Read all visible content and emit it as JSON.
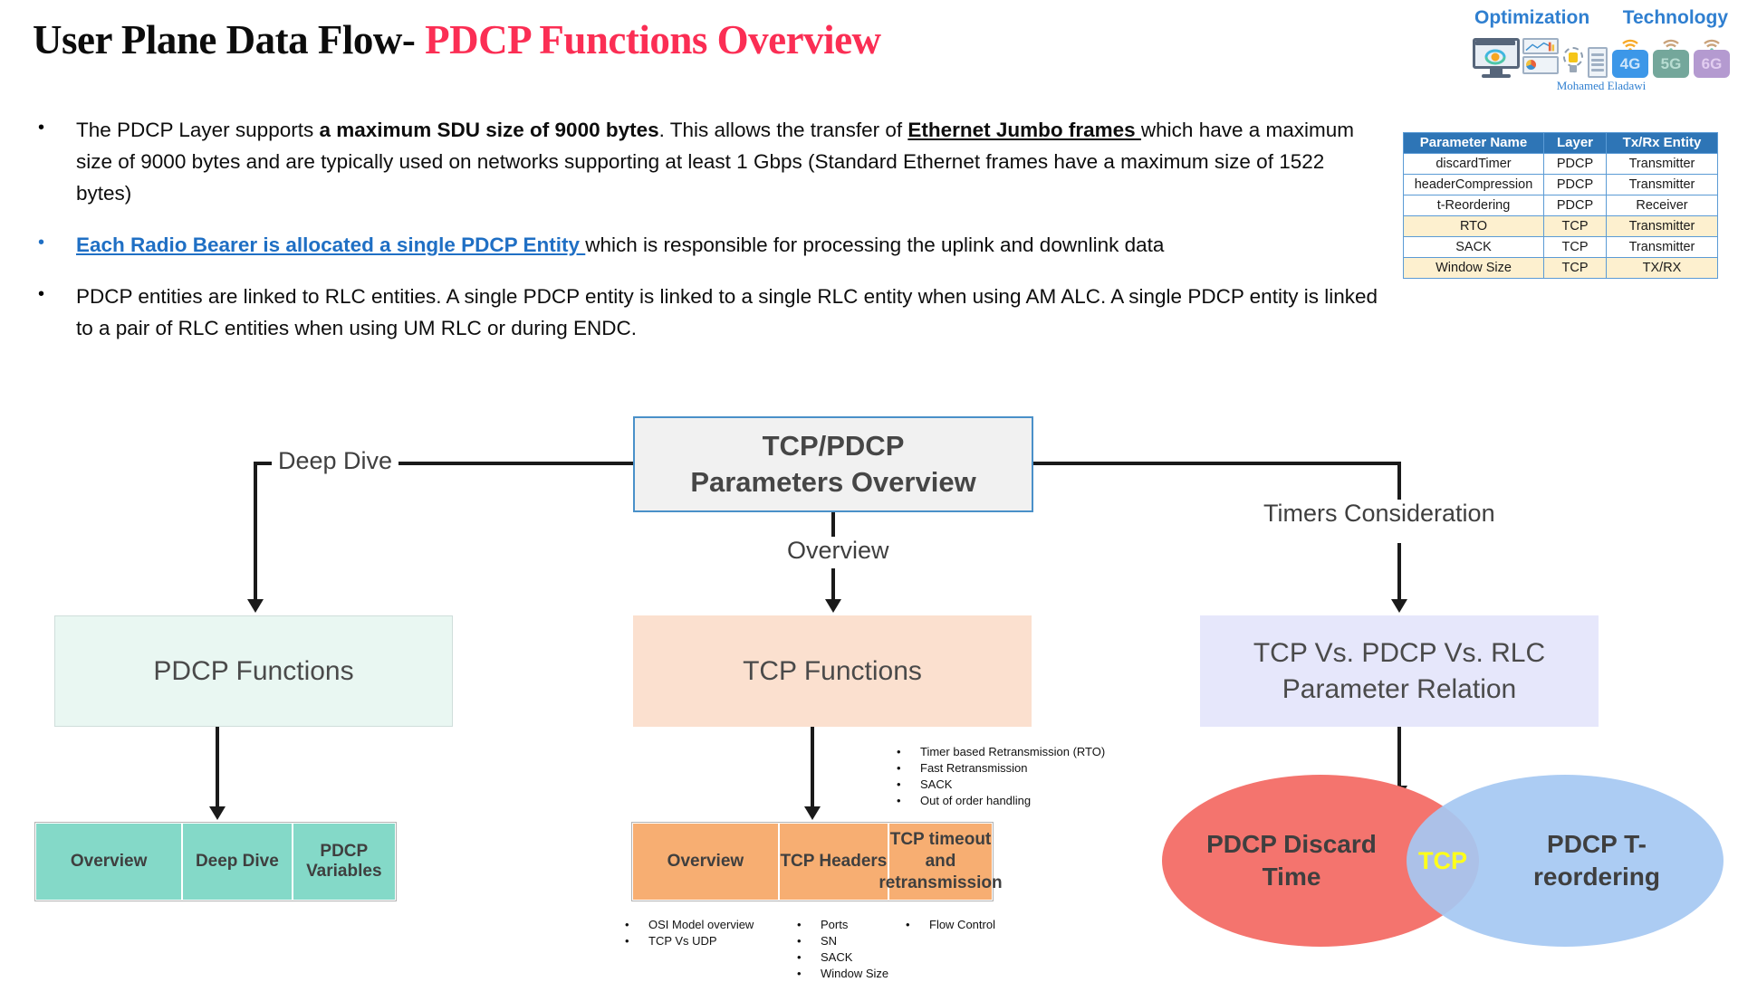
{
  "title": {
    "part1": "User Plane Data Flow- ",
    "part2": "PDCP Functions Overview"
  },
  "logo": {
    "word_left": "Optimization",
    "word_right": "Technology",
    "author": "Mohamed Eladawi",
    "cells": [
      "4G",
      "5G",
      "6G"
    ],
    "accent": "#2f7fd0"
  },
  "bullets": [
    {
      "marker": "•",
      "segments": [
        {
          "text": "The PDCP Layer supports ",
          "style": "plain"
        },
        {
          "text": "a maximum SDU size of 9000 bytes",
          "style": "bold"
        },
        {
          "text": ". This allows the transfer of ",
          "style": "plain"
        },
        {
          "text": "Ethernet Jumbo frames ",
          "style": "bold-underline"
        },
        {
          "text": "which have a maximum size of 9000 bytes and are typically used on networks supporting at least 1 Gbps (Standard Ethernet frames have a maximum size of 1522 bytes)",
          "style": "plain"
        }
      ]
    },
    {
      "marker": "•",
      "segments": [
        {
          "text": "Each Radio Bearer is allocated a single PDCP Entity ",
          "style": "link"
        },
        {
          "text": "which is responsible for processing the uplink and downlink data",
          "style": "plain"
        }
      ]
    },
    {
      "marker": "•",
      "segments": [
        {
          "text": "PDCP entities are linked to RLC entities. A single PDCP entity is linked to a single RLC entity when using AM ALC. A single PDCP entity is linked to a pair of RLC entities when using UM RLC or during ENDC.",
          "style": "plain"
        }
      ]
    }
  ],
  "param_table": {
    "headers": [
      "Parameter Name",
      "Layer",
      "Tx/Rx Entity"
    ],
    "rows": [
      {
        "cells": [
          "discardTimer",
          "PDCP",
          "Transmitter"
        ],
        "highlight": false
      },
      {
        "cells": [
          "headerCompression",
          "PDCP",
          "Transmitter"
        ],
        "highlight": false
      },
      {
        "cells": [
          "t-Reordering",
          "PDCP",
          "Receiver"
        ],
        "highlight": false
      },
      {
        "cells": [
          "RTO",
          "TCP",
          "Transmitter"
        ],
        "highlight": true
      },
      {
        "cells": [
          "SACK",
          "TCP",
          "Transmitter"
        ],
        "highlight": false
      },
      {
        "cells": [
          "Window Size",
          "TCP",
          "TX/RX"
        ],
        "highlight": true
      }
    ],
    "header_color": "#2e75b6",
    "highlight_color": "#fdf0cf"
  },
  "flow": {
    "root": {
      "line1": "TCP/PDCP",
      "line2": "Parameters Overview",
      "border_color": "#4a90c9",
      "fill": "#f1f1f1"
    },
    "edge_labels": {
      "left": "Deep Dive",
      "center": "Overview",
      "right": "Timers Consideration"
    },
    "nodes": {
      "pdcp_functions": {
        "label": "PDCP Functions",
        "fill": "#e9f7f2"
      },
      "tcp_functions": {
        "label": "TCP Functions",
        "fill": "#fbe0cf"
      },
      "relation": {
        "line1": "TCP Vs. PDCP Vs. RLC",
        "line2": "Parameter Relation",
        "fill": "#e6e7fb"
      }
    },
    "pdcp_sub": {
      "fill": "#84d9c8",
      "items": [
        "Overview",
        "Deep Dive",
        "PDCP Variables"
      ]
    },
    "tcp_sub": {
      "fill": "#f7ae72",
      "items": [
        "Overview",
        "TCP Headers",
        "TCP timeout and retransmission"
      ]
    },
    "notes": {
      "retransmission": [
        "Timer based Retransmission (RTO)",
        "Fast Retransmission",
        "SACK",
        "Out of order handling"
      ],
      "overview": [
        "OSI Model overview",
        "TCP Vs UDP"
      ],
      "headers": [
        "Ports",
        "SN",
        "SACK",
        "Window Size"
      ],
      "timeout": [
        "Flow Control"
      ]
    },
    "venn": {
      "left_label": "PDCP Discard Time",
      "right_label": "PDCP T-reordering",
      "center_label": "TCP",
      "left_color": "#f4746e",
      "right_color": "#a5c8f2",
      "center_text_color": "#ffff1a"
    }
  }
}
